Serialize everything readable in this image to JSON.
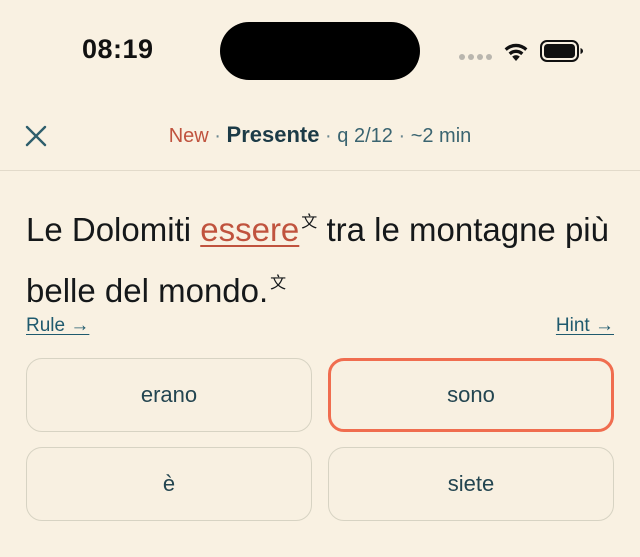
{
  "status_bar": {
    "time": "08:19",
    "icons": [
      "signal-dots-icon",
      "wifi-icon",
      "battery-icon"
    ]
  },
  "header": {
    "close_icon": "close-icon",
    "tag": "New",
    "separator": "·",
    "title": "Presente",
    "question": "q 2/12",
    "duration": "~2 min"
  },
  "sentence": {
    "before": "Le Dolomiti ",
    "blank_word": "essere",
    "after": " tra le montagne più belle del mondo.",
    "translate_icon_glyph": "文"
  },
  "links": {
    "rule": "Rule →",
    "hint": "Hint →"
  },
  "options": [
    {
      "label": "erano",
      "selected": false
    },
    {
      "label": "sono",
      "selected": true
    },
    {
      "label": "è",
      "selected": false
    },
    {
      "label": "siete",
      "selected": false
    }
  ],
  "colors": {
    "background": "#F9F1E2",
    "accent": "#C0533E",
    "selected_border": "#F06D4F",
    "teal_text": "#1F5A6E"
  }
}
